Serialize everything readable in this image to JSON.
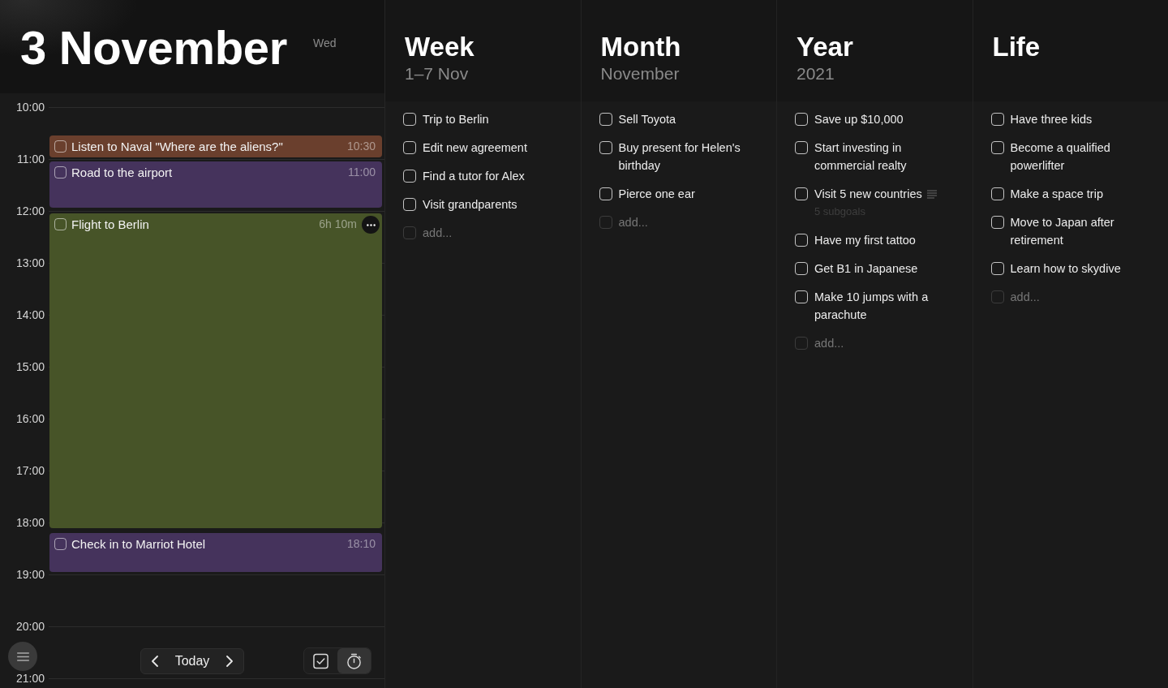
{
  "day": {
    "title": "3 November",
    "weekday": "Wed",
    "hours": [
      "10:00",
      "11:00",
      "12:00",
      "13:00",
      "14:00",
      "15:00",
      "16:00",
      "17:00",
      "18:00",
      "19:00",
      "20:00",
      "21:00"
    ],
    "events": [
      {
        "title": "Listen to Naval \"Where are the aliens?\"",
        "time": "10:30",
        "color": "#6a3f2d",
        "checked": false
      },
      {
        "title": "Road to the airport",
        "time": "11:00",
        "color": "#45335c",
        "checked": false
      },
      {
        "title": "Flight to Berlin",
        "time": "6h 10m",
        "color": "#475428",
        "checked": false,
        "more_button": true
      },
      {
        "title": "Check in to Marriot Hotel",
        "time": "18:10",
        "color": "#45335c",
        "checked": false
      }
    ]
  },
  "toolbar": {
    "today": "Today",
    "views": [
      {
        "kind": "tasks",
        "selected": false
      },
      {
        "kind": "timer",
        "selected": true
      }
    ]
  },
  "columns": [
    {
      "title": "Week",
      "subtitle": "1–7 Nov",
      "items": [
        {
          "text": "Trip to Berlin",
          "checked": false
        },
        {
          "text": "Edit new agreement",
          "checked": false
        },
        {
          "text": "Find a tutor for Alex",
          "checked": false
        },
        {
          "text": "Visit grandparents",
          "checked": false
        }
      ],
      "add_placeholder": "add..."
    },
    {
      "title": "Month",
      "subtitle": "November",
      "items": [
        {
          "text": "Sell Toyota",
          "checked": false
        },
        {
          "text": "Buy present for Helen's birthday",
          "checked": false
        },
        {
          "text": "Pierce one ear",
          "checked": false
        }
      ],
      "add_placeholder": "add..."
    },
    {
      "title": "Year",
      "subtitle": "2021",
      "items": [
        {
          "text": "Save up $10,000",
          "checked": false
        },
        {
          "text": "Start investing in commercial realty",
          "checked": false
        },
        {
          "text": "Visit 5 new countries",
          "checked": false,
          "subgoals": "5 subgoals"
        },
        {
          "text": "Have my first tattoo",
          "checked": false
        },
        {
          "text": "Get B1 in Japanese",
          "checked": false
        },
        {
          "text": "Make 10 jumps with a parachute",
          "checked": false
        }
      ],
      "add_placeholder": "add..."
    },
    {
      "title": "Life",
      "items": [
        {
          "text": "Have three kids",
          "checked": false
        },
        {
          "text": "Become a qualified powerlifter",
          "checked": false
        },
        {
          "text": "Make a space trip",
          "checked": false
        },
        {
          "text": "Move to Japan after retirement",
          "checked": false
        },
        {
          "text": "Learn how to skydive",
          "checked": false
        }
      ],
      "add_placeholder": "add..."
    }
  ]
}
